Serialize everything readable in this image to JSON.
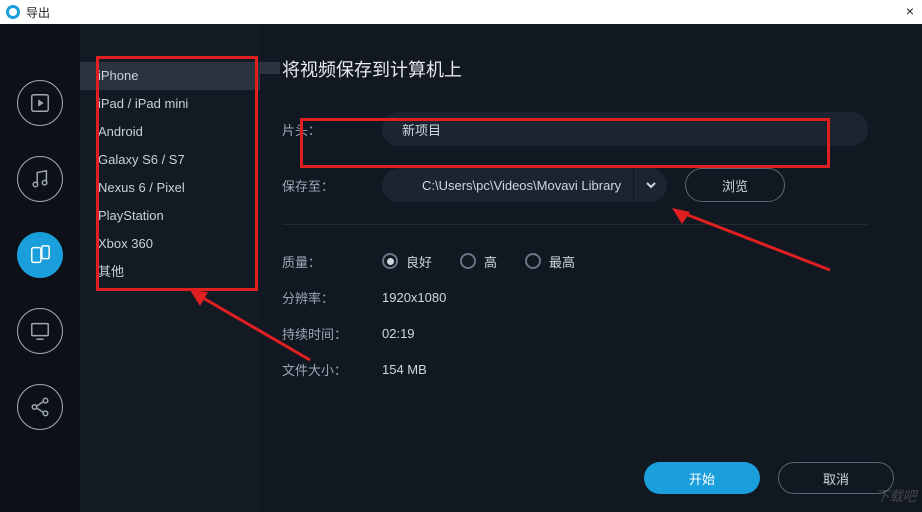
{
  "window": {
    "title": "导出",
    "close": "×"
  },
  "rail": {
    "items": [
      {
        "name": "video-icon"
      },
      {
        "name": "music-icon"
      },
      {
        "name": "device-icon",
        "active": true
      },
      {
        "name": "monitor-icon"
      },
      {
        "name": "share-icon"
      }
    ]
  },
  "devices": {
    "items": [
      "iPhone",
      "iPad / iPad mini",
      "Android",
      "Galaxy S6 / S7",
      "Nexus 6 / Pixel",
      "PlayStation",
      "Xbox 360",
      "其他"
    ],
    "selected_index": 0
  },
  "main": {
    "heading": "将视频保存到计算机上",
    "title_label": "片头：",
    "title_value": "新项目",
    "save_to_label": "保存至：",
    "save_to_value": "C:\\Users\\pc\\Videos\\Movavi Library",
    "browse_label": "浏览",
    "quality_label": "质量：",
    "quality_options": [
      "良好",
      "高",
      "最高"
    ],
    "quality_selected": 0,
    "resolution_label": "分辨率：",
    "resolution_value": "1920x1080",
    "duration_label": "持续时间：",
    "duration_value": "02:19",
    "filesize_label": "文件大小：",
    "filesize_value": "154 MB"
  },
  "footer": {
    "start": "开始",
    "cancel": "取消"
  },
  "watermark": "下载吧"
}
